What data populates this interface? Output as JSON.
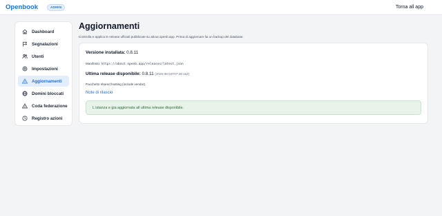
{
  "header": {
    "brand": "Openbook",
    "badge": "ADMIN",
    "back_link": "Torna all app"
  },
  "sidebar": {
    "items": [
      {
        "label": "Dashboard",
        "icon": "home-icon",
        "active": false
      },
      {
        "label": "Segnalazioni",
        "icon": "flag-icon",
        "active": false
      },
      {
        "label": "Utenti",
        "icon": "users-icon",
        "active": false
      },
      {
        "label": "Impostazioni",
        "icon": "gear-icon",
        "active": false
      },
      {
        "label": "Aggiornamenti",
        "icon": "warning-icon",
        "active": true
      },
      {
        "label": "Domini bloccati",
        "icon": "globe-icon",
        "active": false
      },
      {
        "label": "Coda federazione",
        "icon": "warning-icon",
        "active": false
      },
      {
        "label": "Registro azioni",
        "icon": "clock-icon",
        "active": false
      }
    ]
  },
  "main": {
    "title": "Aggiornamenti",
    "description": "Controlla e applica le release ufficiali pubblicate su about.openb.app. Prima di aggiornare fai un backup del database.",
    "installed_label": "Versione installata:",
    "installed_version": "0.8.11",
    "manifest_label": "Manifesto:",
    "manifest_url": "https://about.openb.app/releases/latest.json",
    "latest_label": "Ultima release disponibile:",
    "latest_version": "0.8.11",
    "latest_date": "(2026-08-04T07:29:15Z)",
    "package_text": "Pacchetto shared hosting (include vendor).",
    "notes_link": "Note di rilascio",
    "status_message": "L istanza e gia aggiornata all ultima release disponibile."
  },
  "colors": {
    "accent": "#1d6fd6",
    "active_bg": "#e3eefc",
    "success_bg": "#e8f4ea",
    "success_text": "#2f6b3c"
  }
}
